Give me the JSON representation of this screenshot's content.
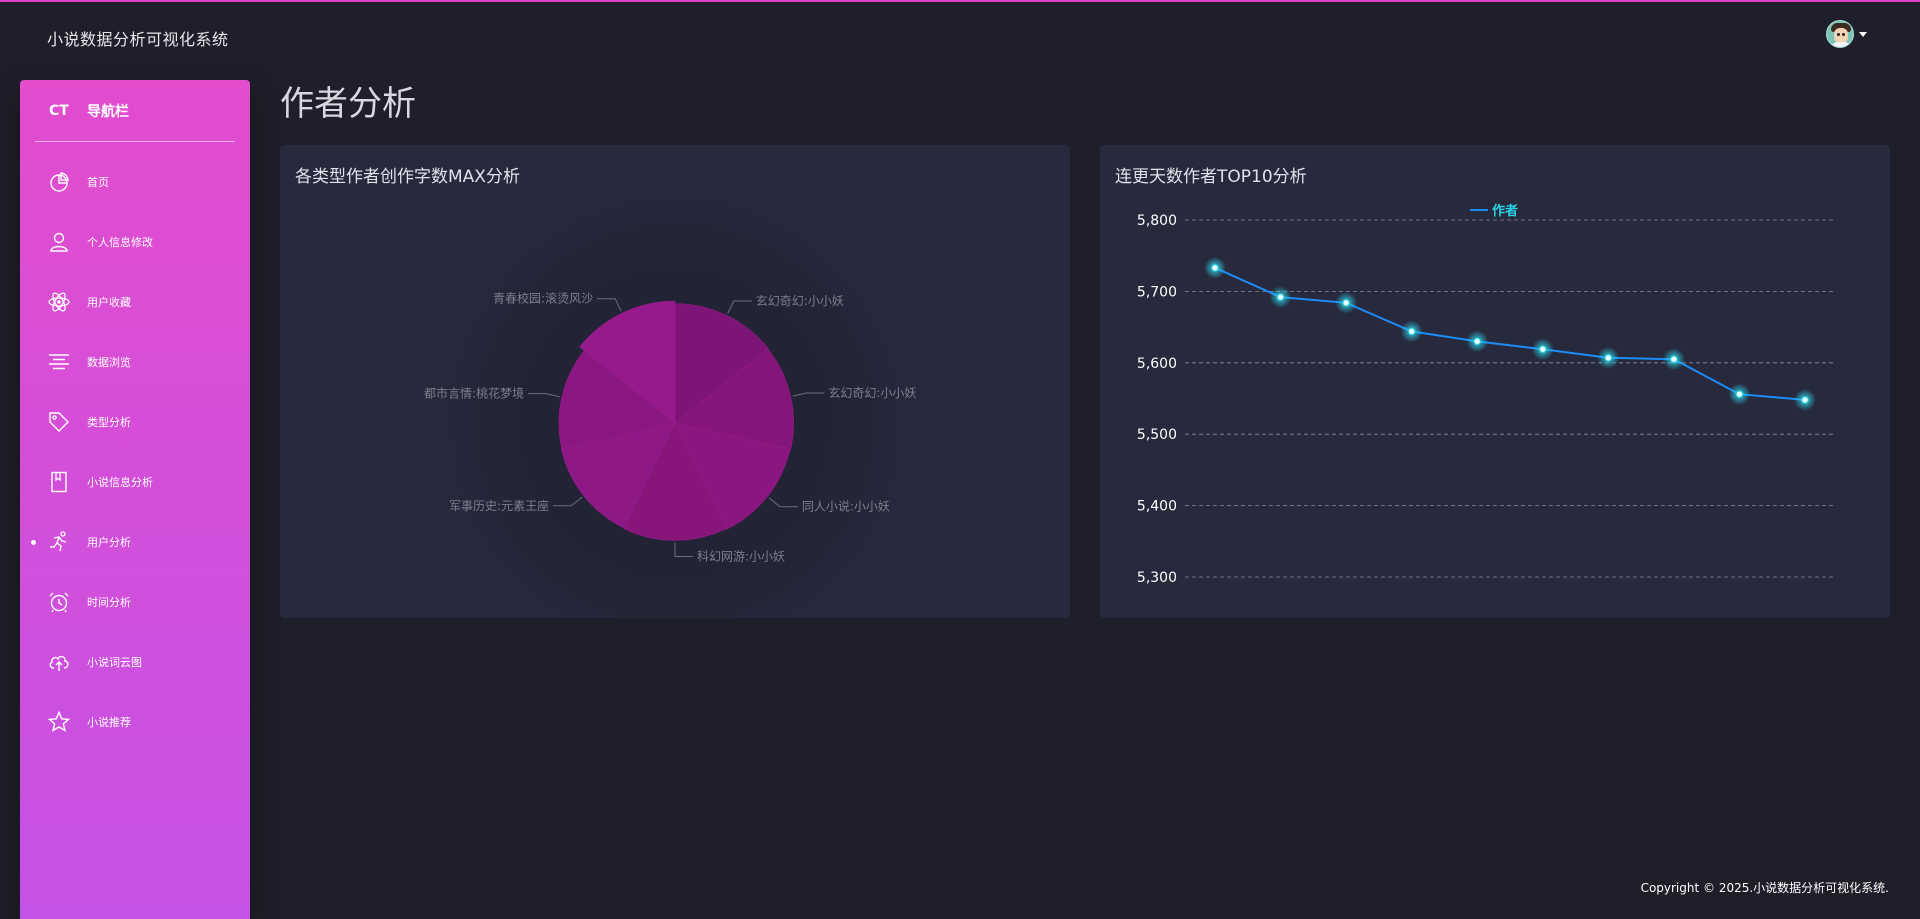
{
  "app_title": "小说数据分析可视化系统",
  "sidebar": {
    "logo_mini": "CT",
    "logo_normal": "导航栏",
    "items": [
      {
        "label": "首页",
        "icon": "pie-chart-icon",
        "active": false
      },
      {
        "label": "个人信息修改",
        "icon": "user-icon",
        "active": false
      },
      {
        "label": "用户收藏",
        "icon": "atom-icon",
        "active": false
      },
      {
        "label": "数据浏览",
        "icon": "align-center-icon",
        "active": false
      },
      {
        "label": "类型分析",
        "icon": "tag-icon",
        "active": false
      },
      {
        "label": "小说信息分析",
        "icon": "book-icon",
        "active": false
      },
      {
        "label": "用户分析",
        "icon": "running-icon",
        "active": true
      },
      {
        "label": "时间分析",
        "icon": "alarm-clock-icon",
        "active": false
      },
      {
        "label": "小说词云图",
        "icon": "cloud-upload-icon",
        "active": false
      },
      {
        "label": "小说推荐",
        "icon": "star-icon",
        "active": false
      }
    ]
  },
  "page": {
    "title": "作者分析"
  },
  "colors": {
    "background": "#1f1f2b",
    "card": "#27293d",
    "sidebar_top": "#e24ccd",
    "sidebar_bottom": "#c552e6",
    "pie": "#8e1787",
    "line": "#1d8cf8",
    "glow": "#2ad4e6"
  },
  "footer": {
    "text": "Copyright © 2025.小说数据分析可视化系统."
  },
  "chart_data": [
    {
      "type": "pie",
      "title": "各类型作者创作字数MAX分析",
      "variant": "rose",
      "slices": [
        {
          "label": "玄幻奇幻:小小妖",
          "value": 93
        },
        {
          "label": "玄幻奇幻:小小妖",
          "value": 92
        },
        {
          "label": "同人小说:小小妖",
          "value": 91
        },
        {
          "label": "科幻网游:小小妖",
          "value": 90
        },
        {
          "label": "军事历史:元素王座",
          "value": 89
        },
        {
          "label": "都市言情:桃花梦境",
          "value": 88
        },
        {
          "label": "青春校园:滚烫风沙",
          "value": 97
        }
      ]
    },
    {
      "type": "line",
      "title": "连更天数作者TOP10分析",
      "legend": [
        "作者"
      ],
      "legend_position": "top-center",
      "ylim": [
        5300,
        5800
      ],
      "y_ticks": [
        5300,
        5400,
        5500,
        5600,
        5700,
        5800
      ],
      "y_tick_labels": [
        "5,300",
        "5,400",
        "5,500",
        "5,600",
        "5,700",
        "5,800"
      ],
      "grid": true,
      "series": [
        {
          "name": "作者",
          "values": [
            5733,
            5692,
            5684,
            5644,
            5630,
            5619,
            5607,
            5605,
            5556,
            5548
          ]
        }
      ]
    }
  ]
}
